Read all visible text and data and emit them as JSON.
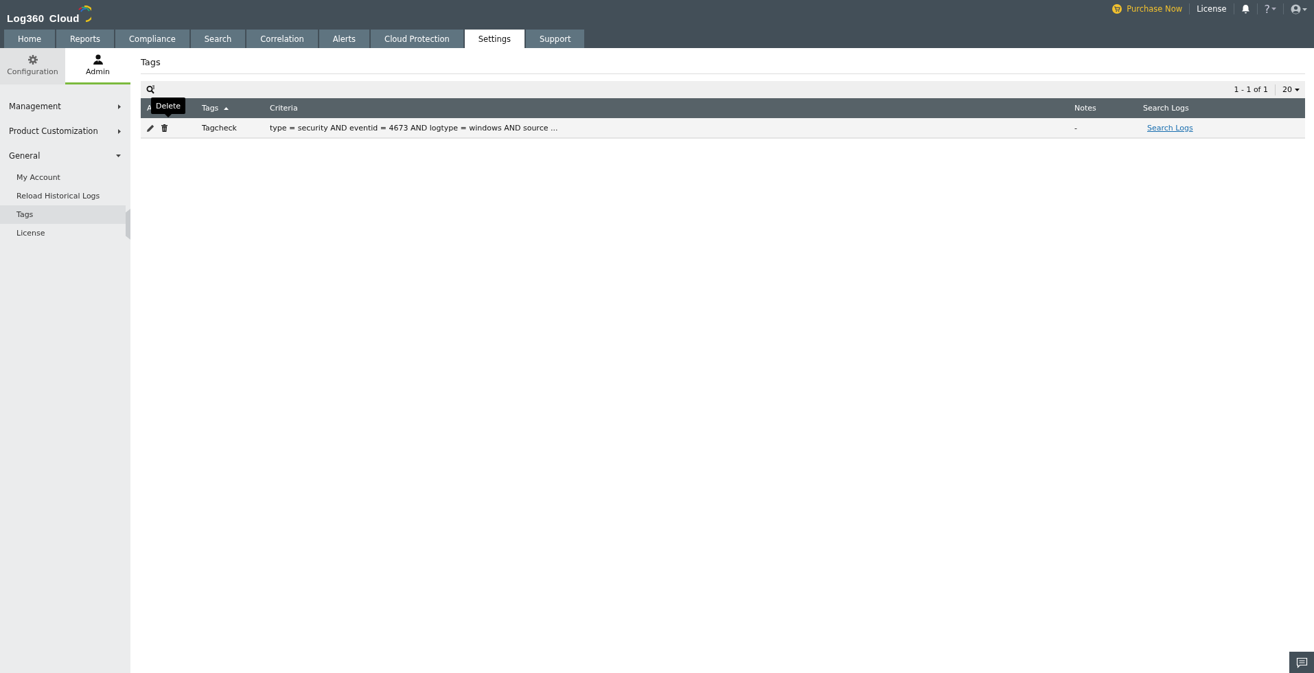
{
  "header": {
    "logo": "Log360 Cloud",
    "purchase": "Purchase Now",
    "license": "License",
    "help": "?"
  },
  "tabs": [
    {
      "label": "Home",
      "selected": false
    },
    {
      "label": "Reports",
      "selected": false
    },
    {
      "label": "Compliance",
      "selected": false
    },
    {
      "label": "Search",
      "selected": false
    },
    {
      "label": "Correlation",
      "selected": false
    },
    {
      "label": "Alerts",
      "selected": false
    },
    {
      "label": "Cloud Protection",
      "selected": false
    },
    {
      "label": "Settings",
      "selected": true
    },
    {
      "label": "Support",
      "selected": false
    }
  ],
  "sidebar": {
    "view_tabs": [
      {
        "label": "Configuration",
        "kind": "gear",
        "selected": false
      },
      {
        "label": "Admin",
        "kind": "user",
        "selected": true
      }
    ],
    "menu": [
      {
        "label": "Management",
        "expanded": false
      },
      {
        "label": "Product Customization",
        "expanded": false
      },
      {
        "label": "General",
        "expanded": true,
        "children": [
          {
            "label": "My Account",
            "selected": false
          },
          {
            "label": "Reload Historical Logs",
            "selected": false
          },
          {
            "label": "Tags",
            "selected": true
          },
          {
            "label": "License",
            "selected": false
          }
        ]
      }
    ]
  },
  "page": {
    "title": "Tags",
    "pagination": "1 - 1 of 1",
    "page_size": "20",
    "table": {
      "columns": [
        {
          "label": "A",
          "sorted": false
        },
        {
          "label": "Tags",
          "sorted": true
        },
        {
          "label": "Criteria",
          "sorted": false
        },
        {
          "label": "Notes",
          "sorted": false
        },
        {
          "label": "Search Logs",
          "sorted": false
        }
      ],
      "rows": [
        {
          "tag": "Tagcheck",
          "criteria": "type = security AND eventid = 4673 AND logtype = windows AND source ...",
          "notes": "-",
          "link": "Search Logs"
        }
      ]
    },
    "tooltip": "Delete"
  }
}
